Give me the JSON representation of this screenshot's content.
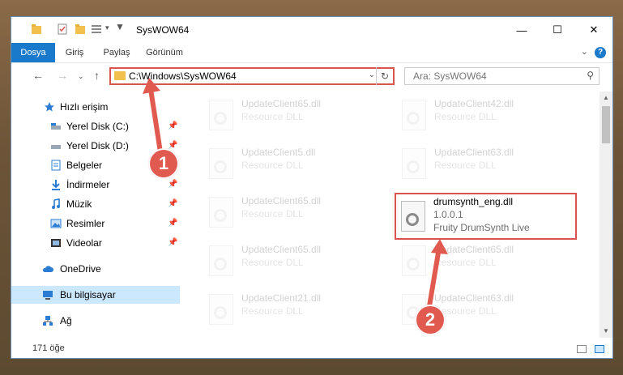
{
  "window": {
    "title": "SysWOW64",
    "controls": [
      "minimize-icon",
      "maximize-icon",
      "close-icon"
    ]
  },
  "ribbon": {
    "tabs": [
      "Dosya",
      "Giriş",
      "Paylaş",
      "Görünüm"
    ],
    "help_label": "?"
  },
  "navigation": {
    "address_path": "C:\\Windows\\SysWOW64",
    "search_placeholder": "Ara: SysWOW64"
  },
  "sidebar": {
    "items": [
      {
        "label": "Hızlı erişim",
        "icon": "star-icon",
        "pinned": false
      },
      {
        "label": "Yerel Disk (C:)",
        "icon": "drive-icon",
        "pinned": true
      },
      {
        "label": "Yerel Disk (D:)",
        "icon": "drive-icon",
        "pinned": true
      },
      {
        "label": "Belgeler",
        "icon": "document-icon",
        "pinned": true
      },
      {
        "label": "İndirmeler",
        "icon": "download-icon",
        "pinned": true
      },
      {
        "label": "Müzik",
        "icon": "music-icon",
        "pinned": true
      },
      {
        "label": "Resimler",
        "icon": "pictures-icon",
        "pinned": true
      },
      {
        "label": "Videolar",
        "icon": "video-icon",
        "pinned": true
      },
      {
        "label": "OneDrive",
        "icon": "cloud-icon",
        "pinned": false
      },
      {
        "label": "Bu bilgisayar",
        "icon": "computer-icon",
        "pinned": false,
        "selected": true
      },
      {
        "label": "Ağ",
        "icon": "network-icon",
        "pinned": false
      }
    ]
  },
  "files": [
    {
      "name": "UpdateClient65.dll",
      "description": "Resource DLL",
      "faded": true
    },
    {
      "name": "UpdateClient42.dll",
      "description": "Resource DLL",
      "faded": true
    },
    {
      "name": "UpdateClient5.dll",
      "description": "Resource DLL",
      "faded": true
    },
    {
      "name": "UpdateClient63.dll",
      "description": "Resource DLL",
      "faded": true
    },
    {
      "name": "UpdateClient65.dll",
      "description": "Resource DLL",
      "faded": true
    },
    {
      "name": "drumsynth_eng.dll",
      "version": "1.0.0.1",
      "description": "Fruity DrumSynth Live",
      "faded": false,
      "highlighted": true
    },
    {
      "name": "UpdateClient65.dll",
      "description": "Resource DLL",
      "faded": true
    },
    {
      "name": "UpdateClient65.dll",
      "description": "Resource DLL",
      "faded": true
    },
    {
      "name": "UpdateClient21.dll",
      "description": "Resource DLL",
      "faded": true
    },
    {
      "name": "UpdateClient63.dll",
      "description": "Resource DLL",
      "faded": true
    }
  ],
  "status": {
    "item_count": "171 öğe"
  },
  "annotations": {
    "marker1": "1",
    "marker2": "2"
  },
  "colors": {
    "accent": "#1979ca",
    "highlight_box": "#d9534f",
    "annotation": "#e05a50"
  }
}
